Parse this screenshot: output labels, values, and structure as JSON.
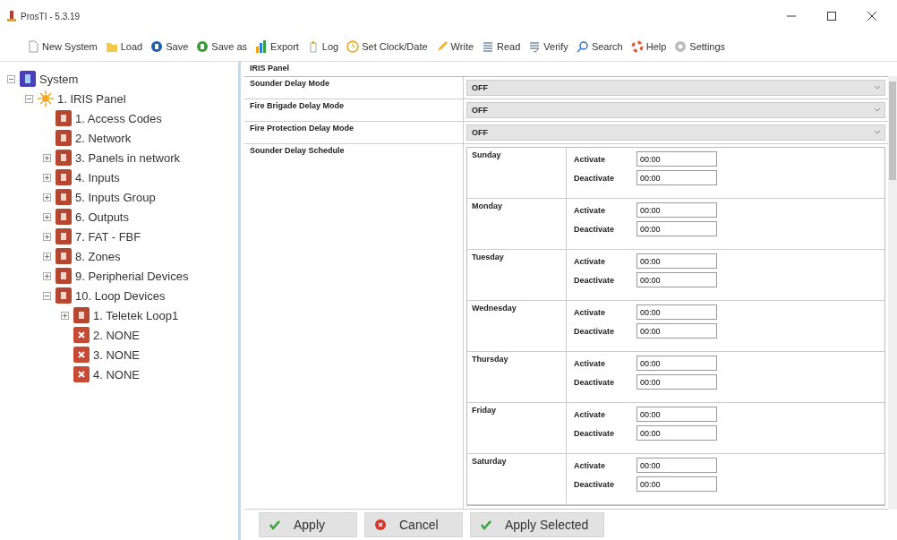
{
  "window": {
    "title": "ProsTI - 5.3.19"
  },
  "toolbar": [
    {
      "kind": "new",
      "label": "New System"
    },
    {
      "kind": "load",
      "label": "Load"
    },
    {
      "kind": "save",
      "label": "Save"
    },
    {
      "kind": "saveas",
      "label": "Save as"
    },
    {
      "kind": "export",
      "label": "Export"
    },
    {
      "kind": "log",
      "label": "Log"
    },
    {
      "kind": "clock",
      "label": "Set Clock/Date"
    },
    {
      "kind": "write",
      "label": "Write"
    },
    {
      "kind": "read",
      "label": "Read"
    },
    {
      "kind": "verify",
      "label": "Verify"
    },
    {
      "kind": "search",
      "label": "Search"
    },
    {
      "kind": "help",
      "label": "Help"
    },
    {
      "kind": "settings",
      "label": "Settings"
    }
  ],
  "tree": [
    {
      "kind": "system",
      "label": "System",
      "expanded": true,
      "children": [
        {
          "kind": "panel",
          "label": "1. IRIS Panel",
          "expanded": true,
          "children": [
            {
              "kind": "module",
              "label": "1. Access Codes"
            },
            {
              "kind": "module",
              "label": "2. Network"
            },
            {
              "kind": "module",
              "label": "3. Panels in network",
              "expanded": false
            },
            {
              "kind": "module",
              "label": "4. Inputs",
              "expanded": false
            },
            {
              "kind": "module",
              "label": "5. Inputs Group",
              "expanded": false
            },
            {
              "kind": "module",
              "label": "6. Outputs",
              "expanded": false
            },
            {
              "kind": "module",
              "label": "7. FAT - FBF",
              "expanded": false
            },
            {
              "kind": "module",
              "label": "8. Zones",
              "expanded": false
            },
            {
              "kind": "module",
              "label": "9. Peripherial Devices",
              "expanded": false
            },
            {
              "kind": "module",
              "label": "10. Loop Devices",
              "expanded": true,
              "children": [
                {
                  "kind": "module",
                  "label": "1. Teletek Loop1",
                  "expanded": false
                },
                {
                  "kind": "none",
                  "label": "2. NONE"
                },
                {
                  "kind": "none",
                  "label": "3. NONE"
                },
                {
                  "kind": "none",
                  "label": "4. NONE"
                }
              ]
            }
          ]
        }
      ]
    }
  ],
  "panel": {
    "title": "IRIS Panel",
    "settings": [
      {
        "label": "Sounder Delay Mode",
        "value": "OFF"
      },
      {
        "label": "Fire Brigade Delay Mode",
        "value": "OFF"
      },
      {
        "label": "Fire Protection Delay Mode",
        "value": "OFF"
      }
    ],
    "schedule": {
      "label": "Sounder Delay Schedule",
      "days": [
        {
          "day": "Sunday",
          "activate_label": "Activate",
          "activate": "00:00",
          "deactivate_label": "Deactivate",
          "deactivate": "00:00"
        },
        {
          "day": "Monday",
          "activate_label": "Activate",
          "activate": "00:00",
          "deactivate_label": "Deactivate",
          "deactivate": "00:00"
        },
        {
          "day": "Tuesday",
          "activate_label": "Activate",
          "activate": "00:00",
          "deactivate_label": "Deactivate",
          "deactivate": "00:00"
        },
        {
          "day": "Wednesday",
          "activate_label": "Activate",
          "activate": "00:00",
          "deactivate_label": "Deactivate",
          "deactivate": "00:00"
        },
        {
          "day": "Thursday",
          "activate_label": "Activate",
          "activate": "00:00",
          "deactivate_label": "Deactivate",
          "deactivate": "00:00"
        },
        {
          "day": "Friday",
          "activate_label": "Activate",
          "activate": "00:00",
          "deactivate_label": "Deactivate",
          "deactivate": "00:00"
        },
        {
          "day": "Saturday",
          "activate_label": "Activate",
          "activate": "00:00",
          "deactivate_label": "Deactivate",
          "deactivate": "00:00"
        }
      ]
    }
  },
  "buttons": [
    {
      "kind": "check",
      "label": "Apply"
    },
    {
      "kind": "cancel",
      "label": "Cancel"
    },
    {
      "kind": "check",
      "label": "Apply Selected"
    }
  ]
}
